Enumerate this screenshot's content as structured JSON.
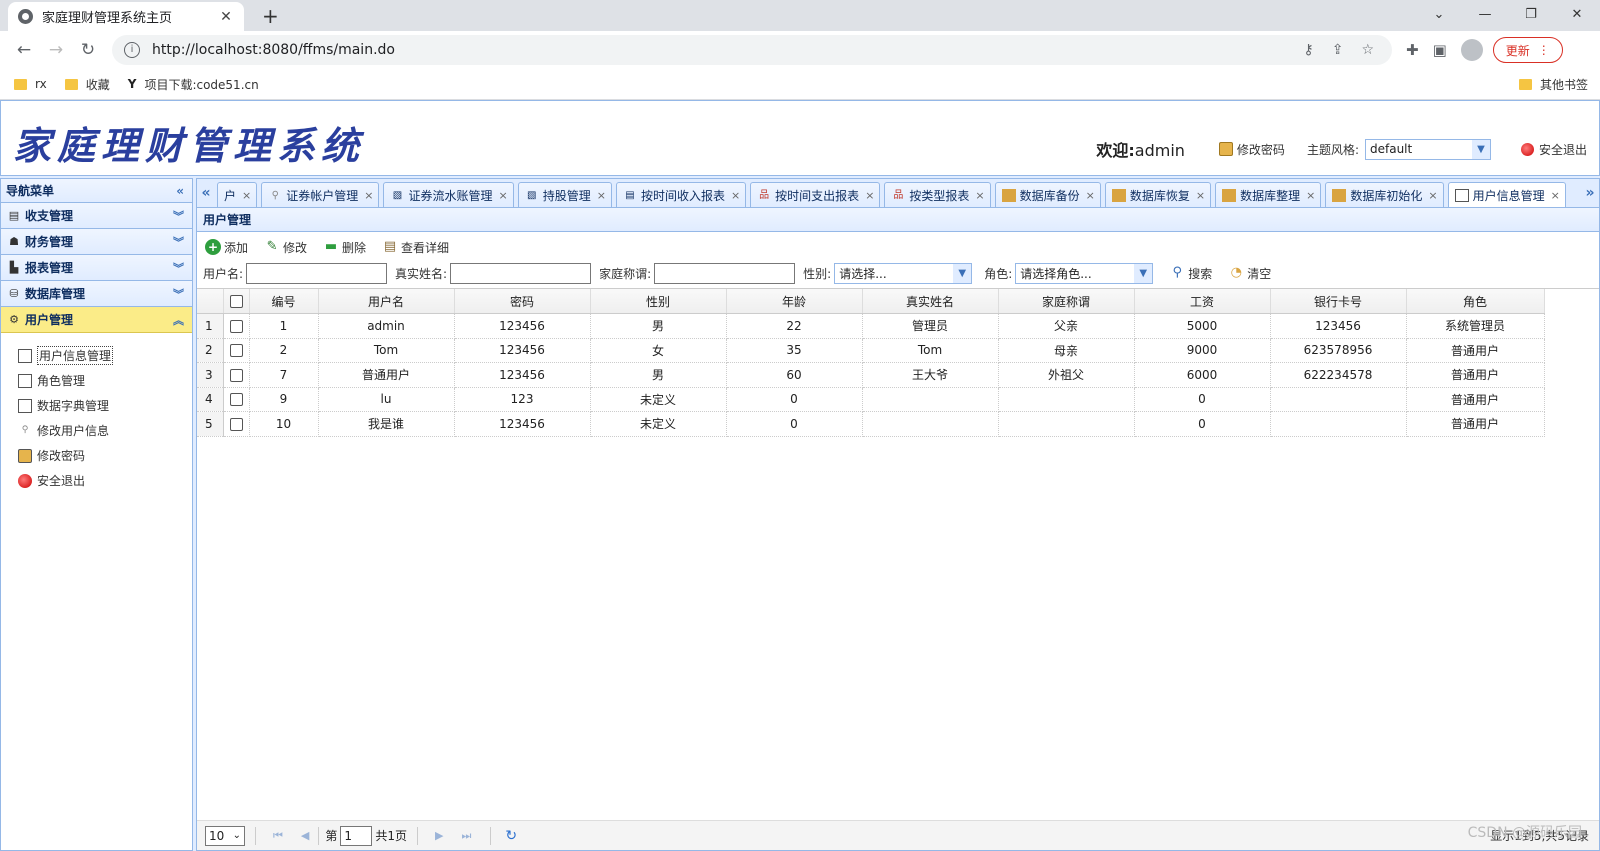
{
  "browser": {
    "tab_title": "家庭理财管理系统主页",
    "url": "http://localhost:8080/ffms/main.do",
    "update_label": "更新",
    "bookmarks": [
      "rx",
      "收藏",
      "项目下载:code51.cn"
    ],
    "other_bookmarks": "其他书签"
  },
  "header": {
    "logo": "家庭理财管理系统",
    "welcome_prefix": "欢迎:",
    "username": "admin",
    "change_password": "修改密码",
    "theme_label": "主题风格:",
    "theme_value": "default",
    "logout": "安全退出"
  },
  "sidebar": {
    "title": "导航菜单",
    "groups": [
      {
        "label": "收支管理"
      },
      {
        "label": "财务管理"
      },
      {
        "label": "报表管理"
      },
      {
        "label": "数据库管理"
      },
      {
        "label": "用户管理"
      }
    ],
    "items": [
      {
        "label": "用户信息管理"
      },
      {
        "label": "角色管理"
      },
      {
        "label": "数据字典管理"
      },
      {
        "label": "修改用户信息"
      },
      {
        "label": "修改密码"
      },
      {
        "label": "安全退出"
      }
    ]
  },
  "tabs": [
    {
      "label": "户"
    },
    {
      "label": "证券帐户管理"
    },
    {
      "label": "证券流水账管理"
    },
    {
      "label": "持股管理"
    },
    {
      "label": "按时间收入报表"
    },
    {
      "label": "按时间支出报表"
    },
    {
      "label": "按类型报表"
    },
    {
      "label": "数据库备份"
    },
    {
      "label": "数据库恢复"
    },
    {
      "label": "数据库整理"
    },
    {
      "label": "数据库初始化"
    },
    {
      "label": "用户信息管理"
    }
  ],
  "panel": {
    "title": "用户管理",
    "toolbar": {
      "add": "添加",
      "edit": "修改",
      "delete": "删除",
      "detail": "查看详细"
    },
    "search": {
      "username_label": "用户名:",
      "realname_label": "真实姓名:",
      "appellation_label": "家庭称谓:",
      "sex_label": "性别:",
      "sex_placeholder": "请选择...",
      "role_label": "角色:",
      "role_placeholder": "请选择角色...",
      "search_btn": "搜索",
      "clear_btn": "清空"
    }
  },
  "grid": {
    "columns": [
      "编号",
      "用户名",
      "密码",
      "性别",
      "年龄",
      "真实姓名",
      "家庭称谓",
      "工资",
      "银行卡号",
      "角色"
    ],
    "rows": [
      {
        "n": "1",
        "c": [
          "1",
          "admin",
          "123456",
          "男",
          "22",
          "管理员",
          "父亲",
          "5000",
          "123456",
          "系统管理员"
        ]
      },
      {
        "n": "2",
        "c": [
          "2",
          "Tom",
          "123456",
          "女",
          "35",
          "Tom",
          "母亲",
          "9000",
          "623578956",
          "普通用户"
        ]
      },
      {
        "n": "3",
        "c": [
          "7",
          "普通用户",
          "123456",
          "男",
          "60",
          "王大爷",
          "外祖父",
          "6000",
          "622234578",
          "普通用户"
        ]
      },
      {
        "n": "4",
        "c": [
          "9",
          "lu",
          "123",
          "未定义",
          "0",
          "",
          "",
          "0",
          "",
          "普通用户"
        ]
      },
      {
        "n": "5",
        "c": [
          "10",
          "我是谁",
          "123456",
          "未定义",
          "0",
          "",
          "",
          "0",
          "",
          "普通用户"
        ]
      }
    ]
  },
  "pager": {
    "page_size": "10",
    "page_prefix": "第",
    "page_num": "1",
    "page_total": "共1页",
    "info": "显示1到5,共5记录"
  },
  "watermark": "CSDN @源码乐园"
}
